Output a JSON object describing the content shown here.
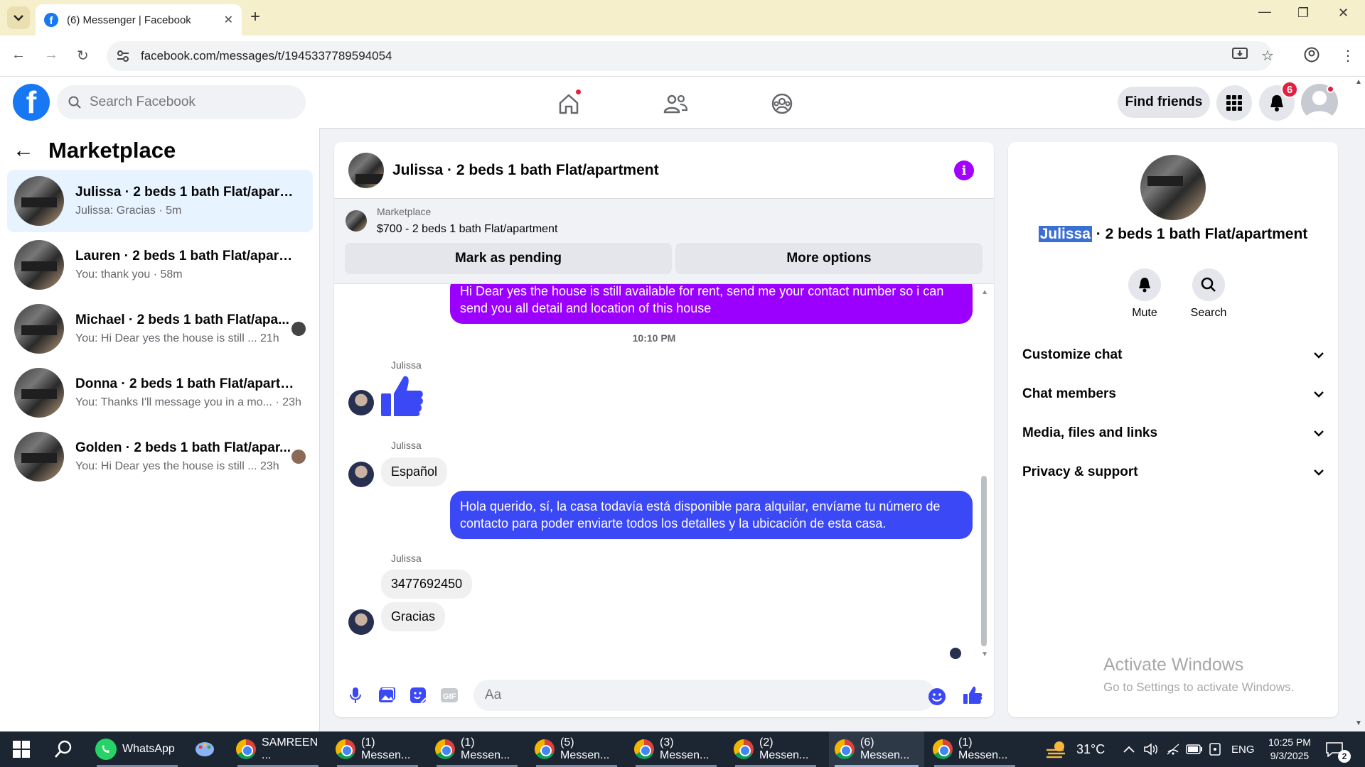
{
  "browser": {
    "tab_title": "(6) Messenger | Facebook",
    "url": "facebook.com/messages/t/1945337789594054"
  },
  "header": {
    "search_placeholder": "Search Facebook",
    "find_friends": "Find friends",
    "notification_count": "6"
  },
  "sidebar": {
    "title": "Marketplace",
    "conversations": [
      {
        "name": "Julissa · 2 beds 1 bath Flat/apartm...",
        "preview": "Julissa: Gracias · 5m"
      },
      {
        "name": "Lauren · 2 beds 1 bath Flat/apartm...",
        "preview": "You: thank you · 58m"
      },
      {
        "name": "Michael · 2 beds 1 bath Flat/apa...",
        "preview": "You: Hi Dear yes the house is still ...  21h"
      },
      {
        "name": "Donna · 2 beds 1 bath Flat/apartm...",
        "preview": "You: Thanks I'll message you in a mo... · 23h"
      },
      {
        "name": "Golden · 2 beds 1 bath Flat/apar...",
        "preview": "You: Hi Dear yes the house is still ...  23h"
      }
    ]
  },
  "chat": {
    "title": "Julissa · 2 beds 1 bath Flat/apartment",
    "marketplace_label": "Marketplace",
    "listing": "$700 - 2 beds 1 bath Flat/apartment",
    "mark_pending": "Mark as pending",
    "more_options": "More options",
    "messages": {
      "out1": "Hi Dear yes the house is still available for rent, send me your contact number so i can send you all detail and location of this house",
      "timestamp": "10:10 PM",
      "sender": "Julissa",
      "in_espanol": "Español",
      "out2": "Hola querido, sí, la casa todavía está disponible para alquilar, envíame tu número de contacto para poder enviarte todos los detalles y la ubicación de esta casa.",
      "in_number": "3477692450",
      "in_gracias": "Gracias"
    },
    "composer_placeholder": "Aa"
  },
  "details": {
    "name_highlight": "Julissa",
    "name_rest": " · 2 beds 1 bath Flat/apartment",
    "mute": "Mute",
    "search": "Search",
    "sections": [
      "Customize chat",
      "Chat members",
      "Media, files and links",
      "Privacy & support"
    ]
  },
  "watermark": {
    "line1": "Activate Windows",
    "line2": "Go to Settings to activate Windows."
  },
  "taskbar": {
    "whatsapp": "WhatsApp",
    "sameen": "SAMREEN ...",
    "windows": [
      "(1) Messen...",
      "(1) Messen...",
      "(5) Messen...",
      "(3) Messen...",
      "(2) Messen...",
      "(6) Messen...",
      "(1) Messen..."
    ],
    "temp": "31°C",
    "lang": "ENG",
    "time": "10:25 PM",
    "date": "9/3/2025",
    "notif": "2"
  },
  "colors": {
    "brand": "#1877f2",
    "outgoing_purple": "#9b00ff",
    "outgoing_blue": "#3b48f5"
  }
}
